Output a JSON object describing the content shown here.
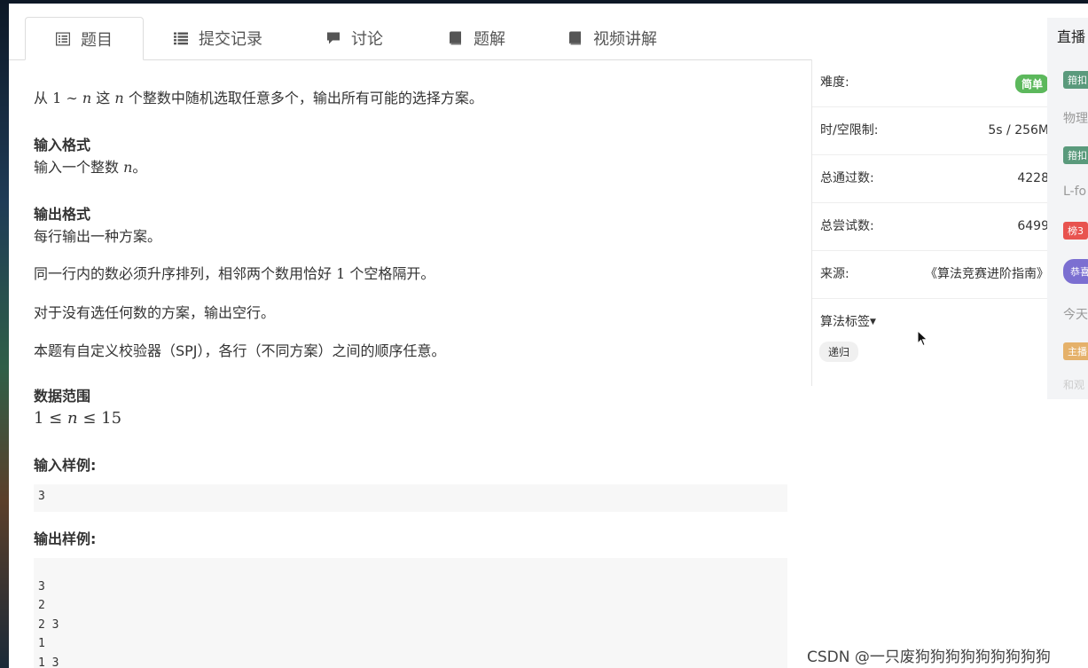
{
  "tabs": [
    {
      "label": "题目",
      "icon": "list-alt-icon",
      "active": true
    },
    {
      "label": "提交记录",
      "icon": "list-icon"
    },
    {
      "label": "讨论",
      "icon": "comment-icon"
    },
    {
      "label": "题解",
      "icon": "book-icon"
    },
    {
      "label": "视频讲解",
      "icon": "book-icon"
    }
  ],
  "problem": {
    "desc_prefix": "从",
    "desc_one": "1",
    "desc_sim": "∼",
    "desc_n": "n",
    "desc_mid": "这",
    "desc_n2": "n",
    "desc_suffix": "个整数中随机选取任意多个，输出所有可能的选择方案。",
    "input_title": "输入格式",
    "input_prefix": "输入一个整数",
    "input_n": "n",
    "input_suffix": "。",
    "output_title": "输出格式",
    "output_lines": [
      "每行输出一种方案。",
      "同一行内的数必须升序排列，相邻两个数用恰好",
      "对于没有选任何数的方案，输出空行。",
      "本题有自定义校验器（SPJ），各行（不同方案）之间的顺序任意。"
    ],
    "output_line2_num": "1",
    "output_line2_suffix": "个空格隔开。",
    "range_title": "数据范围",
    "range_formula_a": "1 ≤",
    "range_formula_n": "n",
    "range_formula_b": "≤ 15",
    "sample_in_title": "输入样例:",
    "sample_in": [
      "3"
    ],
    "sample_out_title": "输出样例:",
    "sample_out": [
      "",
      "3",
      "2",
      "2 3",
      "1",
      "1 3"
    ]
  },
  "sidebar": {
    "difficulty_label": "难度:",
    "difficulty_value": "简单",
    "limit_label": "时/空限制:",
    "limit_value": "5s / 256M",
    "pass_label": "总通过数:",
    "pass_value": "4228",
    "try_label": "总尝试数:",
    "try_value": "6499",
    "source_label": "来源:",
    "source_value": "《算法竞赛进阶指南》",
    "tags_label": "算法标签",
    "tag": "递归"
  },
  "live_panel": {
    "title": "直播",
    "chips": [
      {
        "text": "箝扣",
        "color": "#5a9a7c"
      },
      {
        "text": "箝扣",
        "color": "#5a9a7c"
      },
      {
        "text": "榜3",
        "color": "#e8534f"
      },
      {
        "text": "恭喜",
        "color": "#7b6fd1"
      },
      {
        "text": "主播",
        "color": "#e5b16a"
      }
    ],
    "texts": [
      "物理",
      "L-fo",
      "今天",
      "和观"
    ]
  },
  "watermark": "CSDN @一只废狗狗狗狗狗狗狗狗狗"
}
